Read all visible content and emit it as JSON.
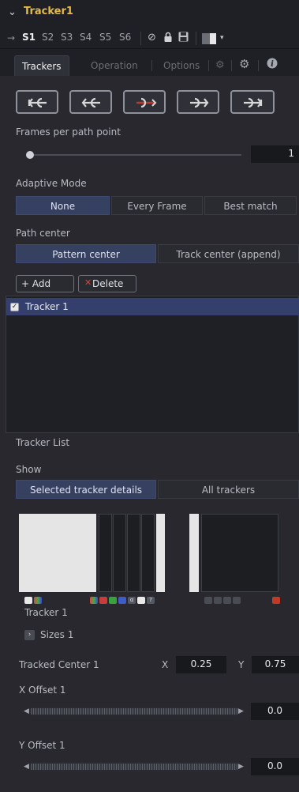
{
  "header": {
    "title": "Tracker1"
  },
  "toolbar": {
    "slots": [
      "S1",
      "S2",
      "S3",
      "S4",
      "S5",
      "S6"
    ],
    "active_slot": "S1"
  },
  "tabs": [
    {
      "label": "Trackers",
      "active": true
    },
    {
      "label": "Operation",
      "active": false
    },
    {
      "label": "Options",
      "active": false
    }
  ],
  "frames_per_path_point": {
    "label": "Frames per path point",
    "value": "1"
  },
  "adaptive_mode": {
    "label": "Adaptive Mode",
    "options": [
      "None",
      "Every Frame",
      "Best match"
    ],
    "selected": "None"
  },
  "path_center": {
    "label": "Path center",
    "options": [
      "Pattern center",
      "Track center (append)"
    ],
    "selected": "Pattern center"
  },
  "tracker_list": {
    "add_label": "+  Add",
    "delete_label": "Delete",
    "items": [
      {
        "label": "Tracker 1",
        "checked": true
      }
    ],
    "caption": "Tracker List"
  },
  "show": {
    "label": "Show",
    "options": [
      "Selected tracker details",
      "All trackers"
    ],
    "selected": "Selected tracker details"
  },
  "tracker_details": {
    "name": "Tracker 1",
    "sizes_label": "Sizes 1",
    "tracked_center_label": "Tracked Center 1",
    "x_label": "X",
    "x_value": "0.25",
    "y_label": "Y",
    "y_value": "0.75",
    "x_offset_label": "X Offset 1",
    "x_offset_value": "0.0",
    "y_offset_label": "Y Offset 1",
    "y_offset_value": "0.0"
  },
  "colors": {
    "accent": "#e6b84a",
    "selected": "#364061",
    "delete": "#c0392b"
  }
}
